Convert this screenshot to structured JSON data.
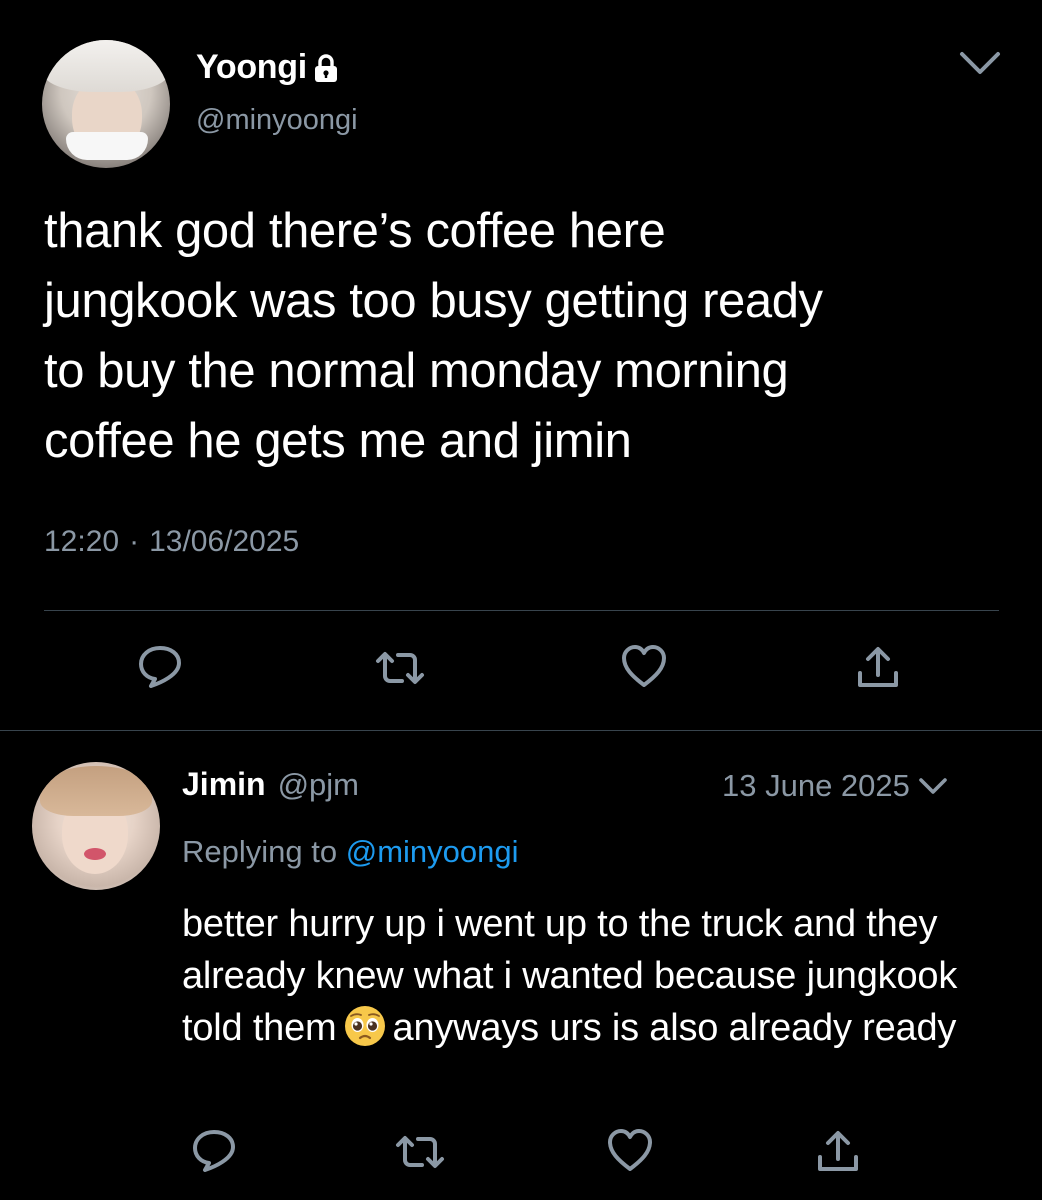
{
  "main_tweet": {
    "author_name": "Yoongi",
    "author_handle": "@minyoongi",
    "text": "thank god there’s coffee here\njungkook was too busy getting ready\nto buy the normal monday morning\ncoffee he gets me and jimin",
    "time": "12:20",
    "separator": "·",
    "date": "13/06/2025",
    "icons": {
      "protected": "lock-icon",
      "menu": "chevron-down-icon",
      "reply": "comment-icon",
      "retweet": "retweet-icon",
      "like": "heart-icon",
      "share": "share-icon"
    }
  },
  "reply_tweet": {
    "author_name": "Jimin",
    "author_handle": "@pjm",
    "date": "13 June 2025",
    "replying_prefix": "Replying to",
    "replying_to": "@minyoongi",
    "text_before_emoji": "better hurry up i went up to the truck and they already knew what i wanted because jungkook told them",
    "emoji": "pleading-face-emoji",
    "text_after_emoji": "anyways urs is also already ready",
    "icons": {
      "menu": "chevron-down-icon",
      "reply": "comment-icon",
      "retweet": "retweet-icon",
      "like": "heart-icon",
      "share": "share-icon"
    }
  },
  "colors": {
    "background": "#000000",
    "text": "#ffffff",
    "secondary_text": "#8b98a5",
    "link": "#1d9bf0",
    "divider": "#38444d"
  }
}
